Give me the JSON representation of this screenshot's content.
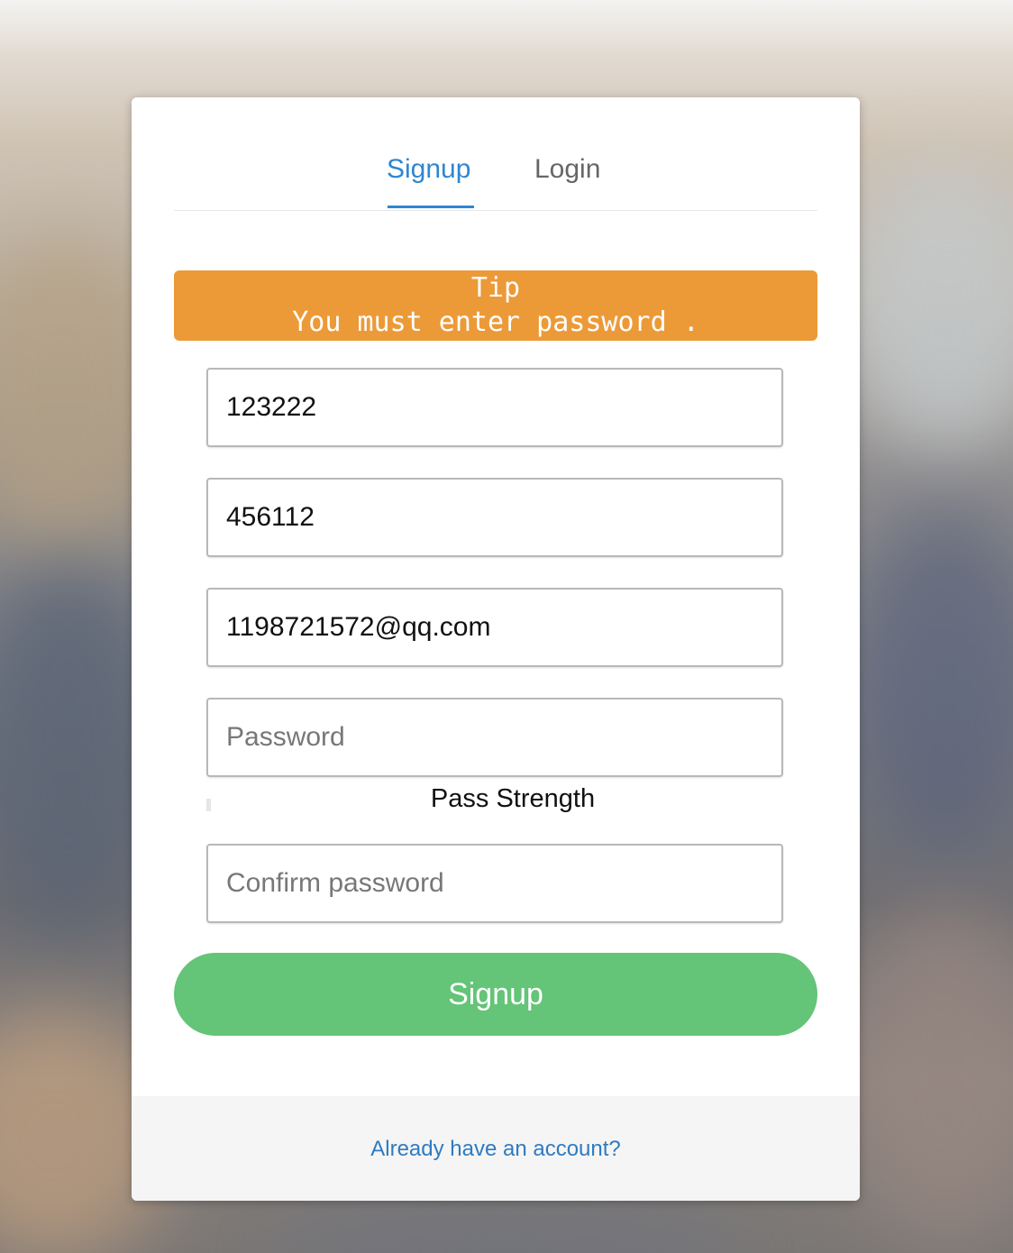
{
  "tabs": {
    "signup_label": "Signup",
    "login_label": "Login",
    "active": "Signup"
  },
  "tip": {
    "title": "Tip",
    "message": "You must enter password ."
  },
  "form": {
    "username_value": "123222",
    "field2_value": "456112",
    "email_value": "1198721572@qq.com",
    "password_placeholder": "Password",
    "password_value": "",
    "strength_label": "Pass Strength",
    "strength_level": 0,
    "confirm_placeholder": "Confirm password",
    "confirm_value": "",
    "submit_label": "Signup"
  },
  "footer": {
    "link_text": "Already have an account?"
  },
  "colors": {
    "accent": "#2f86d0",
    "tip_background": "#ec9a38",
    "submit_background": "#64c477",
    "link": "#2f7bc0"
  }
}
